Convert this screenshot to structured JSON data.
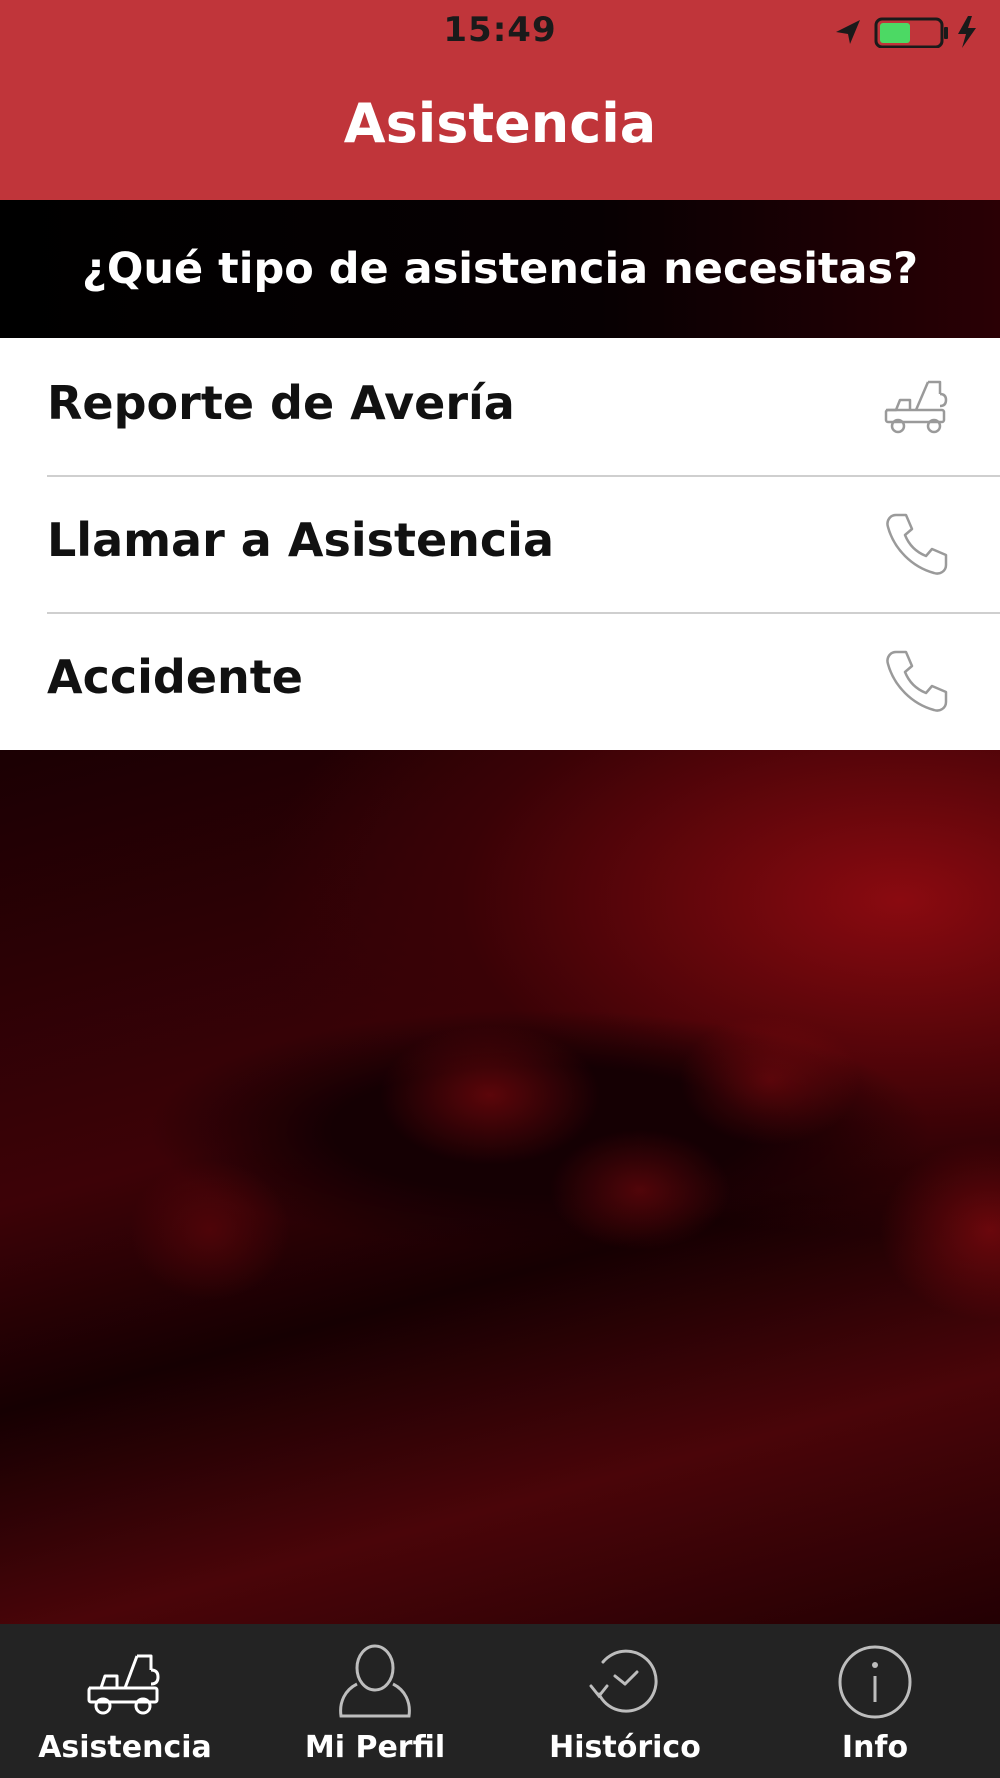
{
  "status_bar": {
    "time": "15:49"
  },
  "header": {
    "title": "Asistencia"
  },
  "question": "¿Qué tipo de asistencia necesitas?",
  "menu": {
    "items": [
      {
        "label": "Reporte de Avería",
        "icon": "tow-truck-icon"
      },
      {
        "label": "Llamar a Asistencia",
        "icon": "phone-icon"
      },
      {
        "label": "Accidente",
        "icon": "phone-icon"
      }
    ]
  },
  "tab_bar": {
    "tabs": [
      {
        "label": "Asistencia",
        "icon": "tow-truck-icon"
      },
      {
        "label": "Mi Perfil",
        "icon": "user-icon"
      },
      {
        "label": "Histórico",
        "icon": "history-icon"
      },
      {
        "label": "Info",
        "icon": "info-icon"
      }
    ]
  },
  "colors": {
    "accent": "#c0353a",
    "tab_bar": "#232323",
    "battery": "#4cd964"
  }
}
